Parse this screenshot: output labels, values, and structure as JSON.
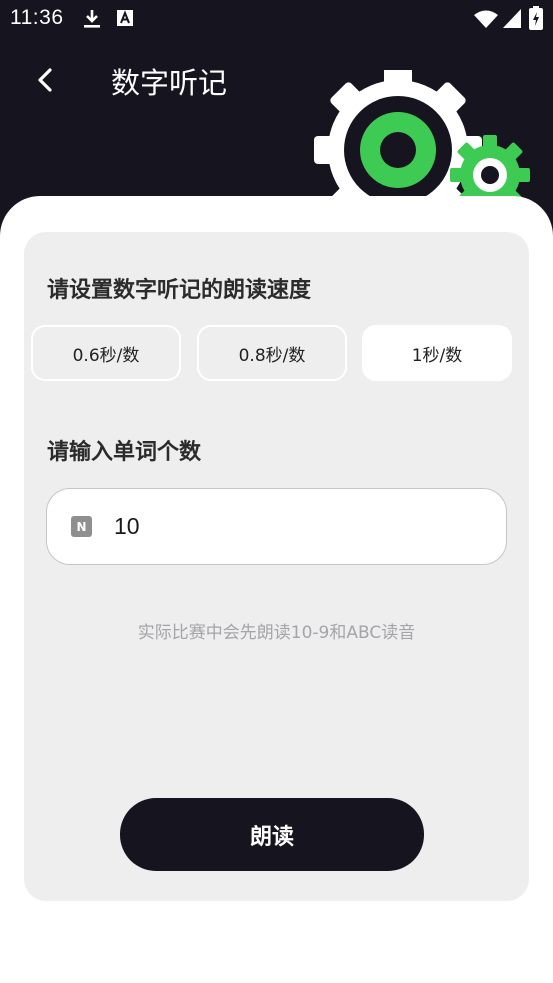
{
  "status_bar": {
    "time": "11:36",
    "icons": [
      "download-icon",
      "font-a-icon",
      "wifi-icon",
      "signal-icon",
      "battery-icon"
    ]
  },
  "header": {
    "title": "数字听记",
    "back_icon": "chevron-left-icon"
  },
  "speed_section": {
    "title": "请设置数字听记的朗读速度",
    "options": [
      "0.6秒/数",
      "0.8秒/数",
      "1秒/数"
    ],
    "selected": "1秒/数"
  },
  "count_section": {
    "title": "请输入单词个数",
    "input_icon": "N",
    "value": "10"
  },
  "hint": "实际比赛中会先朗读10-9和ABC读音",
  "read_button": "朗读",
  "colors": {
    "header_bg": "#16141f",
    "card_bg": "#eeeeee",
    "gear_green": "#3ecb53",
    "button_bg": "#16141f"
  }
}
